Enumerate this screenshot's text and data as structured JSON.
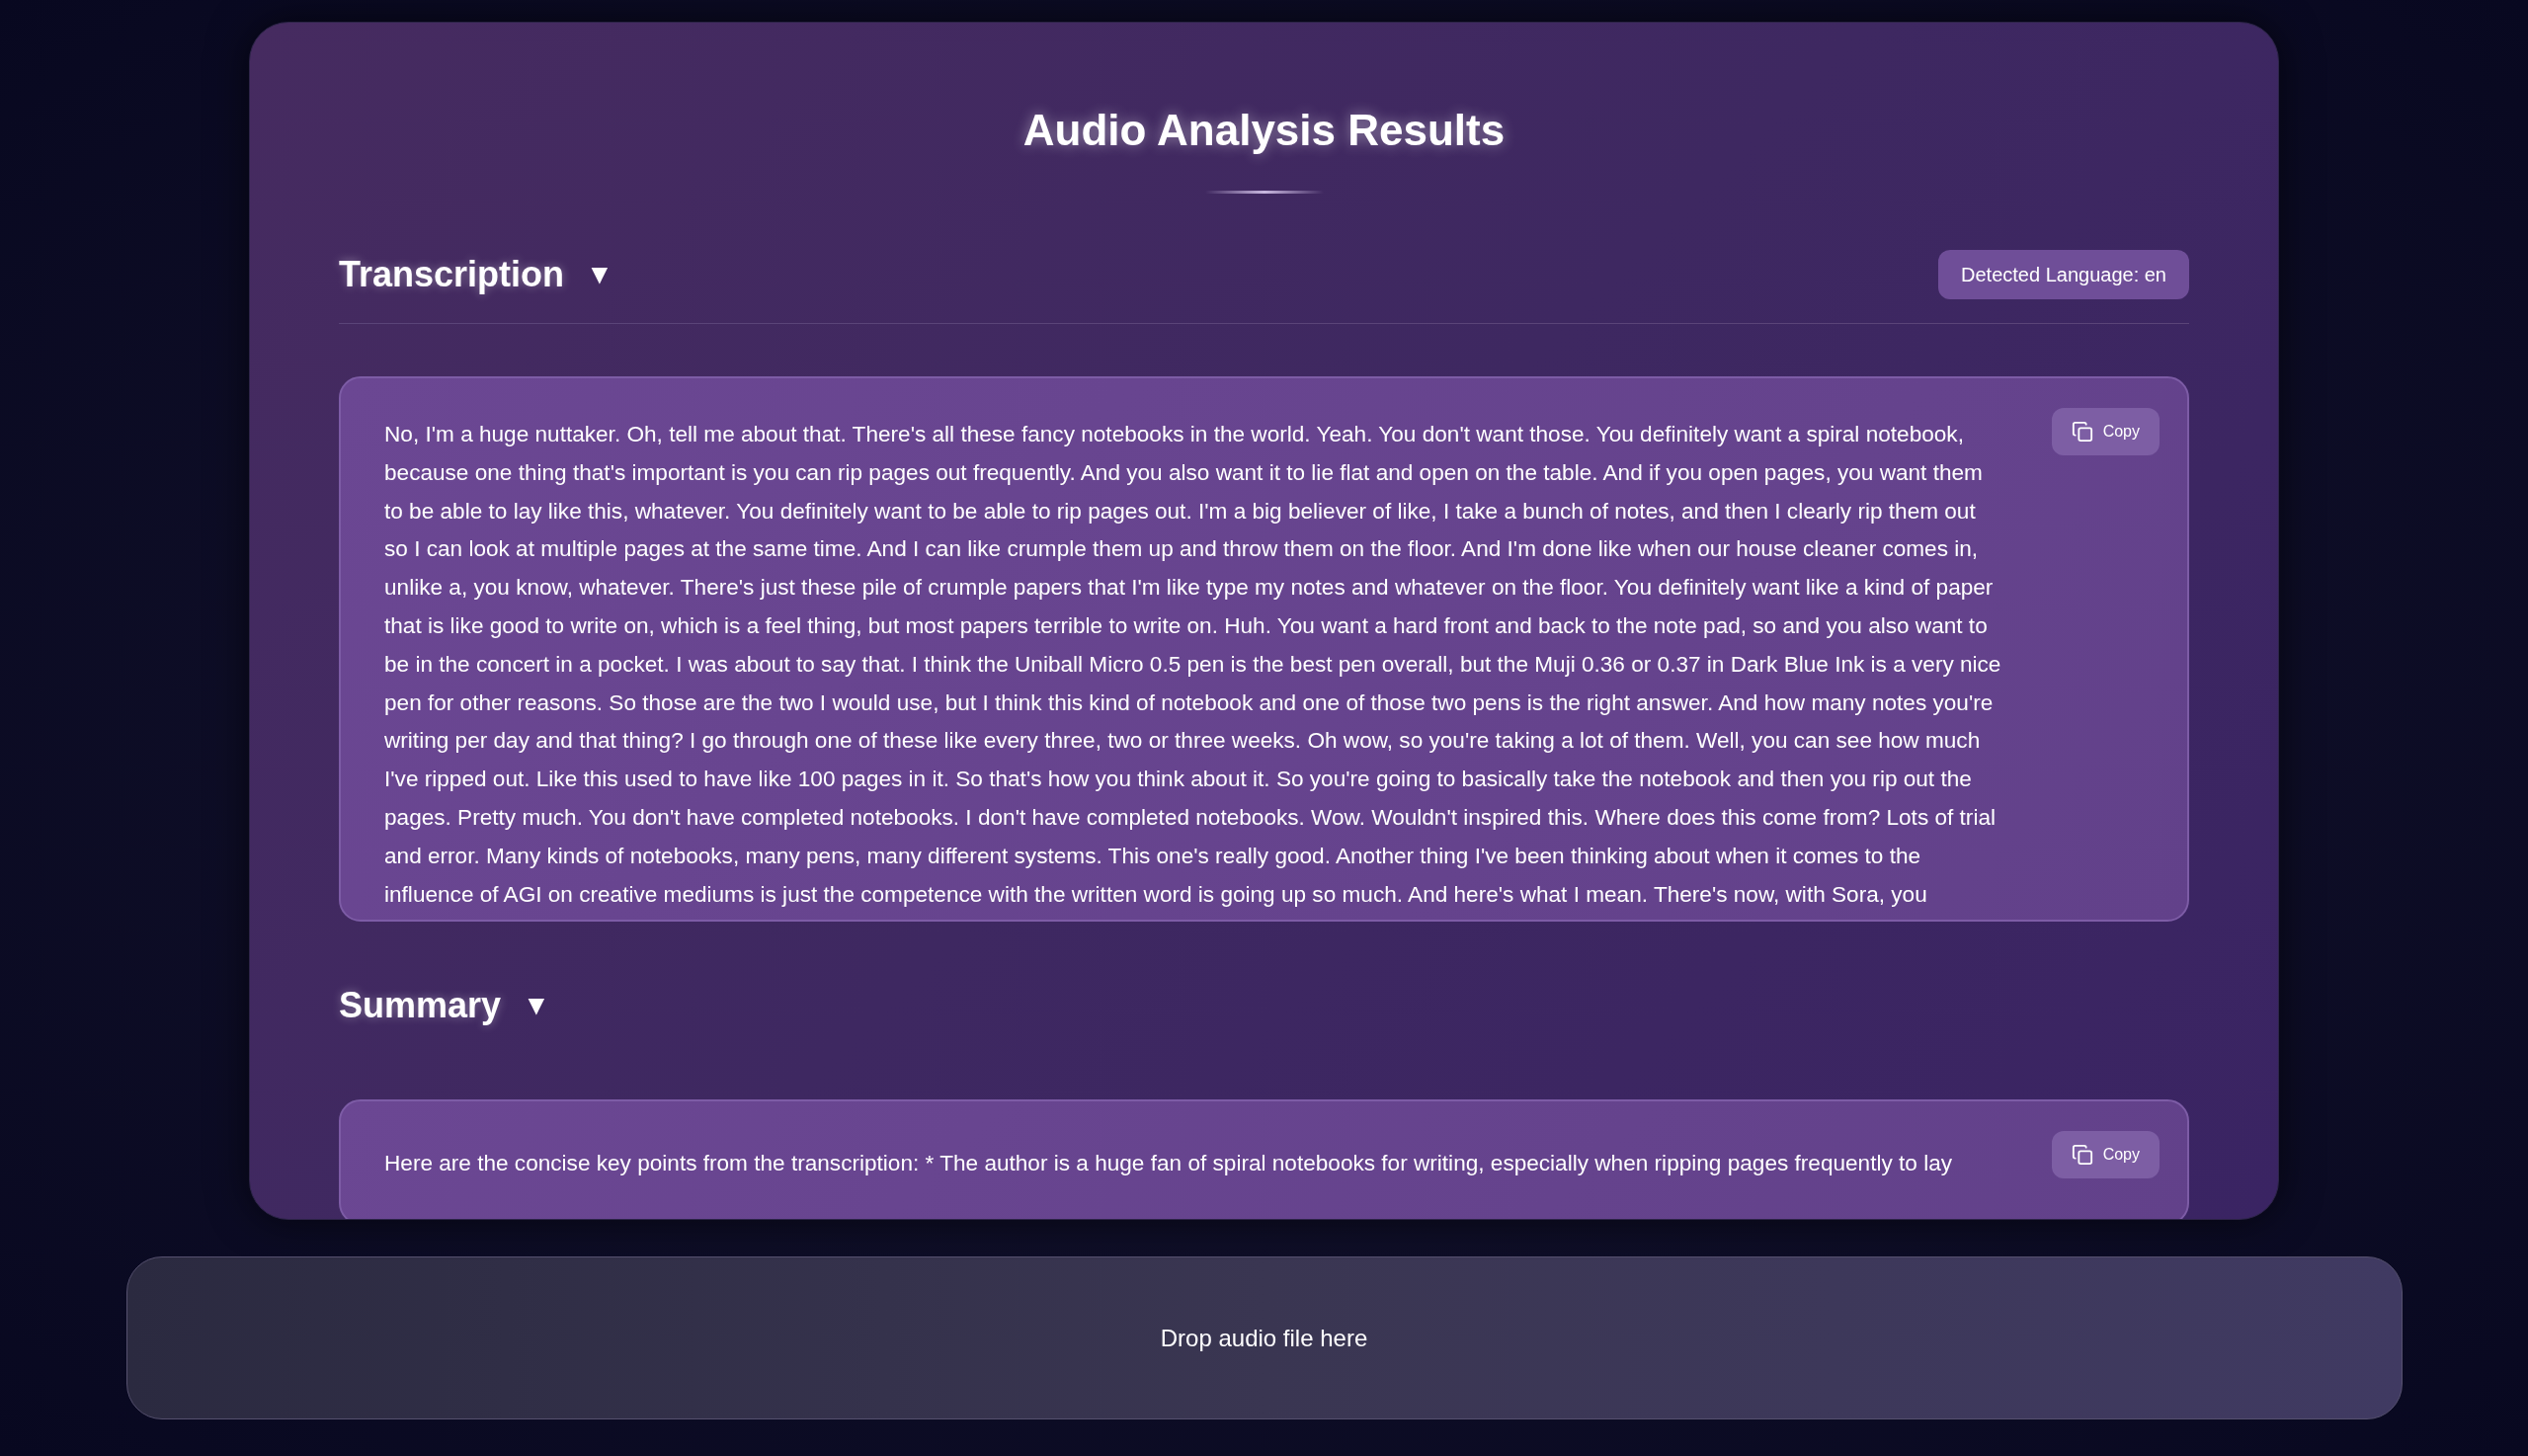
{
  "title": "Audio Analysis Results",
  "sections": [
    {
      "kind": "transcription",
      "heading": "Transcription",
      "toggle": "▼",
      "expanded": true,
      "badge": "Detected Language: en",
      "copy_label": "Copy",
      "text": "No, I'm a huge nuttaker. Oh, tell me about that. There's all these fancy notebooks in the world. Yeah. You don't want those. You definitely want a spiral notebook, because one thing that's important is you can rip pages out frequently. And you also want it to lie flat and open on the table. And if you open pages, you want them to be able to lay like this, whatever. You definitely want to be able to rip pages out. I'm a big believer of like, I take a bunch of notes, and then I clearly rip them out so I can look at multiple pages at the same time. And I can like crumple them up and throw them on the floor. And I'm done like when our house cleaner comes in, unlike a, you know, whatever. There's just these pile of crumple papers that I'm like type my notes and whatever on the floor. You definitely want like a kind of paper that is like good to write on, which is a feel thing, but most papers terrible to write on. Huh. You want a hard front and back to the note pad, so and you also want to be in the concert in a pocket. I was about to say that. I think the Uniball Micro 0.5 pen is the best pen overall, but the Muji 0.36 or 0.37 in Dark Blue Ink is a very nice pen for other reasons. So those are the two I would use, but I think this kind of notebook and one of those two pens is the right answer. And how many notes you're writing per day and that thing? I go through one of these like every three, two or three weeks. Oh wow, so you're taking a lot of them. Well, you can see how much I've ripped out. Like this used to have like 100 pages in it. So that's how you think about it. So you're going to basically take the notebook and then you rip out the pages. Pretty much. You don't have completed notebooks. I don't have completed notebooks. Wow. Wouldn't inspired this. Where does this come from? Lots of trial and error. Many kinds of notebooks, many pens, many different systems. This one's really good. Another thing I've been thinking about when it comes to the influence of AGI on creative mediums is just the competence with the written word is going up so much. And here's what I mean. There's now, with Sora, you"
    },
    {
      "kind": "summary",
      "heading": "Summary",
      "toggle": "▼",
      "expanded": true,
      "copy_label": "Copy",
      "text": "Here are the concise key points from the transcription: * The author is a huge fan of spiral notebooks for writing, especially when ripping pages frequently to lay"
    }
  ],
  "dropzone": {
    "label": "Drop audio file here"
  }
}
